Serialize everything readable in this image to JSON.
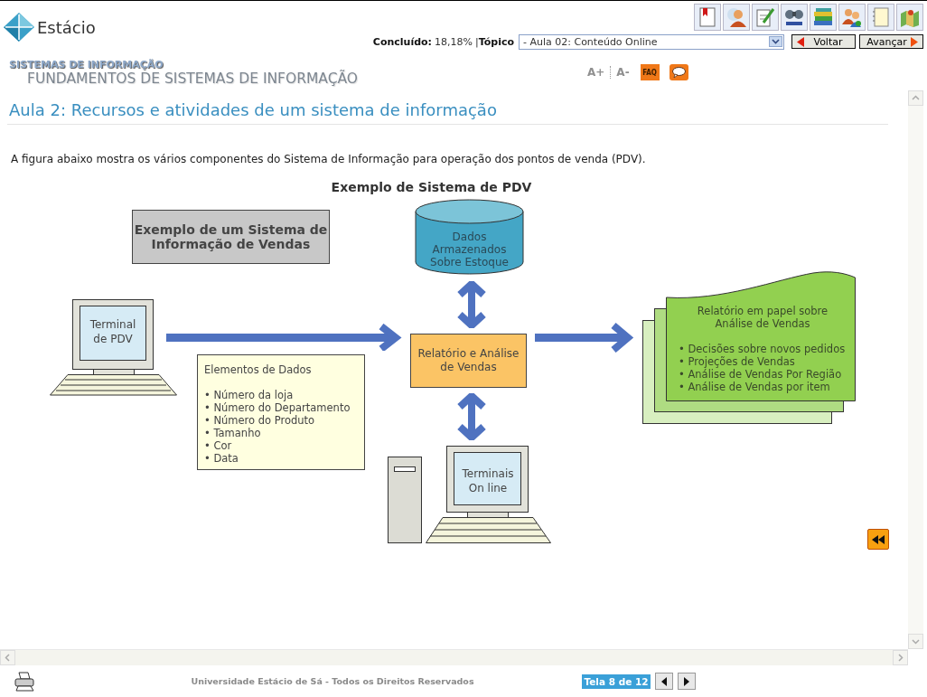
{
  "header": {
    "logo": "Estácio",
    "progress_label": "Concluído:",
    "progress_value": "18,18%",
    "separator": "|",
    "topic_label": "Tópico",
    "topic_value": "- Aula 02: Conteúdo Online",
    "back": "Voltar",
    "next": "Avançar"
  },
  "course": {
    "area": "SISTEMAS DE INFORMAÇÃO",
    "discipline": "FUNDAMENTOS DE SISTEMAS DE INFORMAÇÃO"
  },
  "text_tools": {
    "increase": "A+",
    "decrease": "A-",
    "faq": "FAQ"
  },
  "lesson_title": "Aula 2: Recursos e atividades de um sistema de informação",
  "intro": "A figura abaixo mostra os vários componentes do Sistema de Informação para operação dos pontos de venda (PDV).",
  "diagram": {
    "title": "Exemplo de Sistema de PDV",
    "caption": "Exemplo de um Sistema de\nInformação de Vendas",
    "database": "Dados\nArmazenados\nSobre Estoque",
    "terminal": "Terminal\nde PDV",
    "process": "Relatório e Análise\nde Vendas",
    "online_terminals": "Terminais\nOn line",
    "data_elements": {
      "title": "Elementos de Dados",
      "items": [
        "• Número da loja",
        "• Número do Departamento",
        "• Número do Produto",
        "• Tamanho",
        "• Cor",
        "• Data"
      ]
    },
    "report": {
      "title": "Relatório em papel sobre\nAnálise de Vendas",
      "items": [
        "• Decisões sobre novos pedidos",
        "• Projeções de Vendas",
        "• Análise de Vendas Por Região",
        "• Análise de Vendas por item"
      ]
    }
  },
  "footer": {
    "copyright": "Universidade Estácio de Sá - Todos os Direitos Reservados",
    "page": "Tela 8 de 12"
  }
}
